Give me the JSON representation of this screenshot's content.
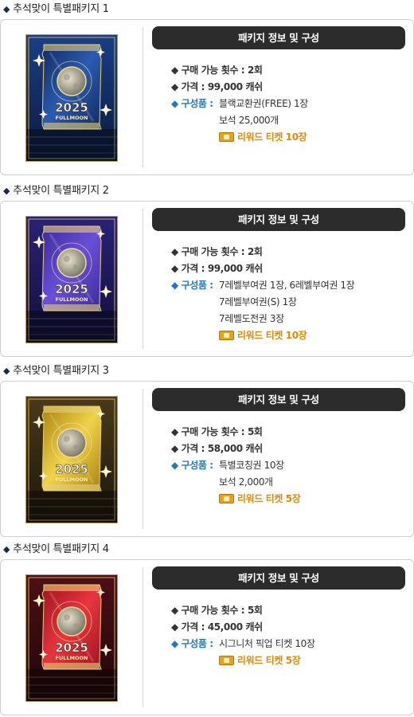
{
  "packages": [
    {
      "title": "추석맞이 특별패키지 1",
      "header": "패키지 정보 및 구성",
      "limit": "◆ 구매 가능 횟수 : 2회",
      "price": "◆ 가격 : 99,000 캐쉬",
      "items_label": "◆ 구성품 :",
      "items": [
        "블랙교환권(FREE) 1장",
        "보석 25,000개"
      ],
      "reward": "리워드 티켓 10장",
      "theme": {
        "bg1": "#0b1a3c",
        "bg2": "#1a3f86",
        "foil": "#122a5e",
        "foil2": "#2b5bb0"
      }
    },
    {
      "title": "추석맞이 특별패키지 2",
      "header": "패키지 정보 및 구성",
      "limit": "◆ 구매 가능 횟수 : 2회",
      "price": "◆ 가격 : 99,000 캐쉬",
      "items_label": "◆ 구성품 :",
      "items": [
        "7레벨부여권 1장, 6레벨부여권 1장",
        "7레벨부여권(S) 1장",
        "7레벨도전권 3장"
      ],
      "reward": "리워드 티켓 10장",
      "theme": {
        "bg1": "#12103a",
        "bg2": "#2a2278",
        "foil": "#3b2a9a",
        "foil2": "#6a4fd8"
      }
    },
    {
      "title": "추석맞이 특별패키지 3",
      "header": "패키지 정보 및 구성",
      "limit": "◆ 구매 가능 횟수 : 5회",
      "price": "◆ 가격 : 58,000 캐쉬",
      "items_label": "◆ 구성품 :",
      "items": [
        "특별코칭권 10장",
        "보석 2,000개"
      ],
      "reward": "리워드 티켓 5장",
      "theme": {
        "bg1": "#1d160a",
        "bg2": "#4a3a1a",
        "foil": "#a8820f",
        "foil2": "#f0d24a"
      }
    },
    {
      "title": "추석맞이 특별패키지 4",
      "header": "패키지 정보 및 구성",
      "limit": "◆ 구매 가능 횟수 : 5회",
      "price": "◆ 가격 : 45,000 캐쉬",
      "items_label": "◆ 구성품 :",
      "items": [
        "시그니처 픽업 티켓 10장"
      ],
      "reward": "리워드 티켓 5장",
      "theme": {
        "bg1": "#1e0709",
        "bg2": "#4d1016",
        "foil": "#9e1420",
        "foil2": "#e8353f"
      }
    }
  ],
  "pack_text": {
    "year": "2025",
    "name": "FULLMOON"
  }
}
